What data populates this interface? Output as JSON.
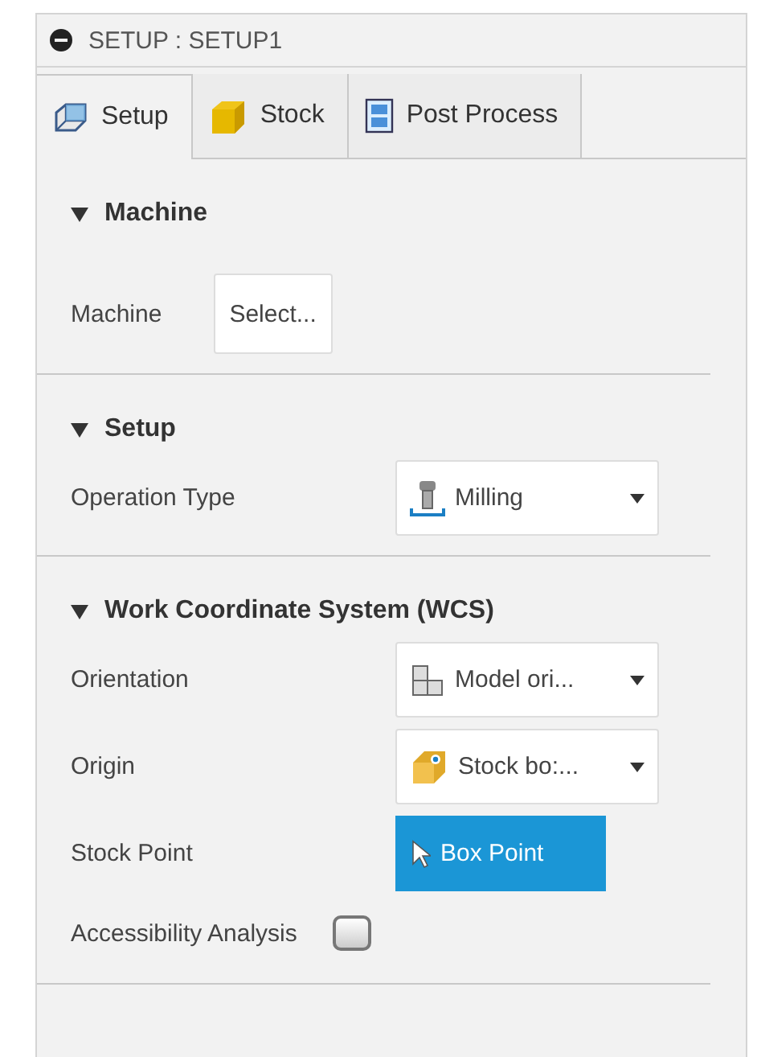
{
  "header": {
    "title": "SETUP : SETUP1"
  },
  "tabs": [
    {
      "label": "Setup",
      "kind": "setup",
      "selected": true
    },
    {
      "label": "Stock",
      "kind": "stock",
      "selected": false
    },
    {
      "label": "Post Process",
      "kind": "post",
      "selected": false
    }
  ],
  "sections": [
    {
      "title": "Machine",
      "expanded": true,
      "rows": [
        {
          "kind": "button",
          "label": "Machine",
          "value": "Select..."
        }
      ]
    },
    {
      "title": "Setup",
      "expanded": true,
      "rows": [
        {
          "kind": "milling",
          "label": "Operation Type",
          "value": "Milling"
        }
      ]
    },
    {
      "title": "Work Coordinate System (WCS)",
      "expanded": true,
      "rows": [
        {
          "kind": "orientation",
          "label": "Orientation",
          "value": "Model ori..."
        },
        {
          "kind": "origin",
          "label": "Origin",
          "value": "Stock bo:..."
        },
        {
          "kind": "pick",
          "label": "Stock Point",
          "value": "Box Point"
        },
        {
          "kind": "checkbox",
          "label": "Accessibility Analysis",
          "checked": false
        }
      ]
    }
  ]
}
